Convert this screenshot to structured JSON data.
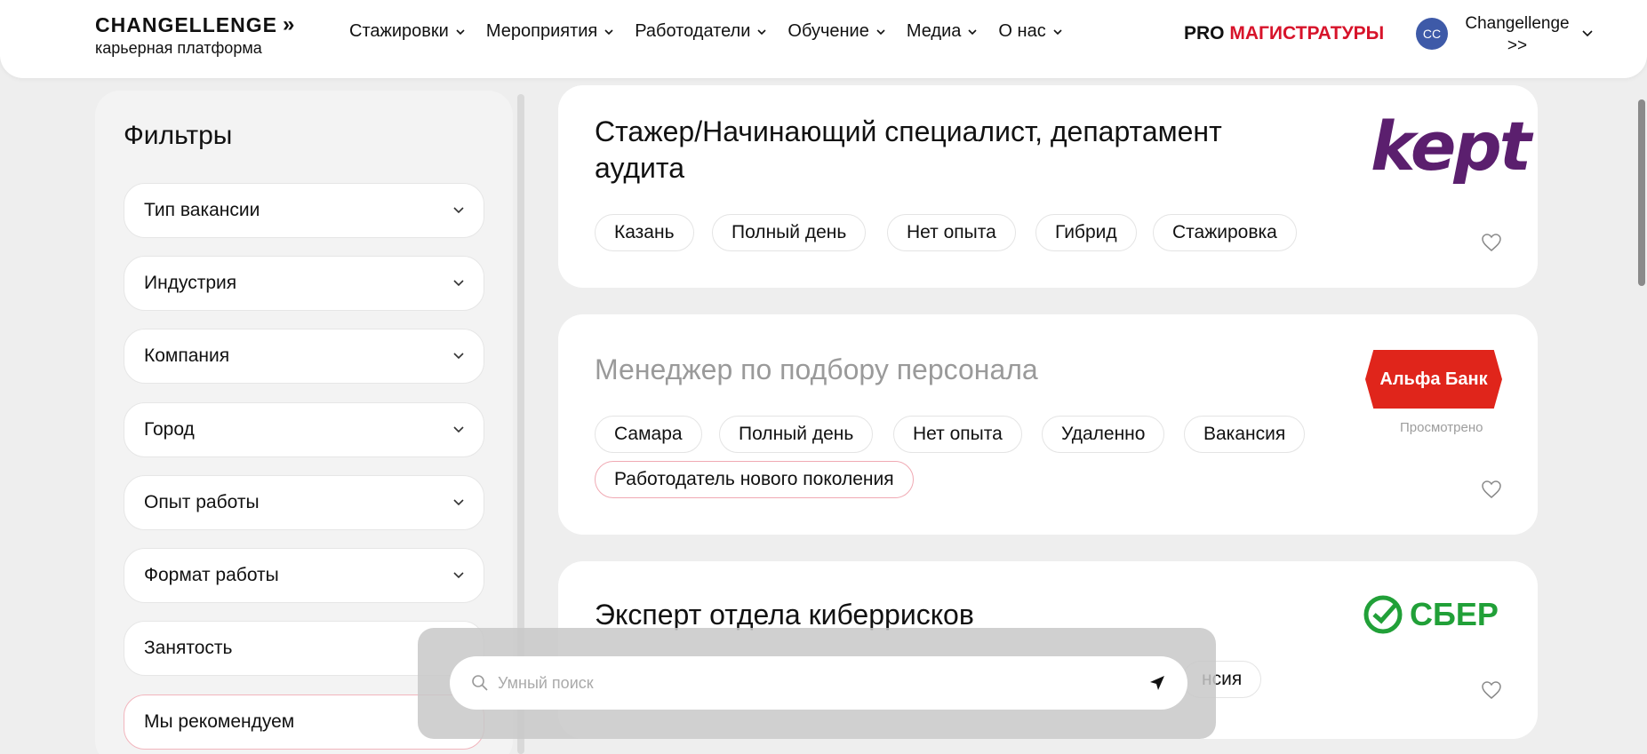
{
  "header": {
    "logo_title": "CHANGELLENGE",
    "logo_sub": "карьерная платформа",
    "nav": [
      {
        "label": "Стажировки"
      },
      {
        "label": "Мероприятия"
      },
      {
        "label": "Работодатели"
      },
      {
        "label": "Обучение"
      },
      {
        "label": "Медиа"
      },
      {
        "label": "О нас"
      }
    ],
    "pro_prefix": "PRO",
    "pro_accent": "МАГИСТРАТУРЫ",
    "avatar_initials": "CC",
    "user_name": "Changellenge",
    "user_suffix": ">>"
  },
  "filters": {
    "title": "Фильтры",
    "items": [
      {
        "label": "Тип вакансии"
      },
      {
        "label": "Индустрия"
      },
      {
        "label": "Компания"
      },
      {
        "label": "Город"
      },
      {
        "label": "Опыт работы"
      },
      {
        "label": "Формат работы"
      },
      {
        "label": "Занятость"
      },
      {
        "label": "Мы рекомендуем"
      }
    ]
  },
  "vacancies": [
    {
      "title_line1": "Стажер/Начинающий специалист, департамент",
      "title_line2": "аудита",
      "logo_text": "kept",
      "tags": [
        "Казань",
        "Полный день",
        "Нет опыта",
        "Гибрид",
        "Стажировка"
      ]
    },
    {
      "title": "Менеджер по подбору персонала",
      "logo_text": "Альфа Банк",
      "viewed_label": "Просмотрено",
      "tags": [
        "Самара",
        "Полный день",
        "Нет опыта",
        "Удаленно",
        "Вакансия"
      ],
      "highlight_tag": "Работодатель нового поколения"
    },
    {
      "title": "Эксперт отдела киберрисков",
      "logo_text": "СБЕР",
      "partial_tag": "нсия"
    }
  ],
  "search": {
    "placeholder": "Умный поиск"
  },
  "colors": {
    "accent_red": "#d7132a",
    "kept_purple": "#5b1f6e",
    "alfa_red": "#e0251b",
    "sber_green": "#21a038",
    "avatar_blue": "#3e5aa8"
  }
}
